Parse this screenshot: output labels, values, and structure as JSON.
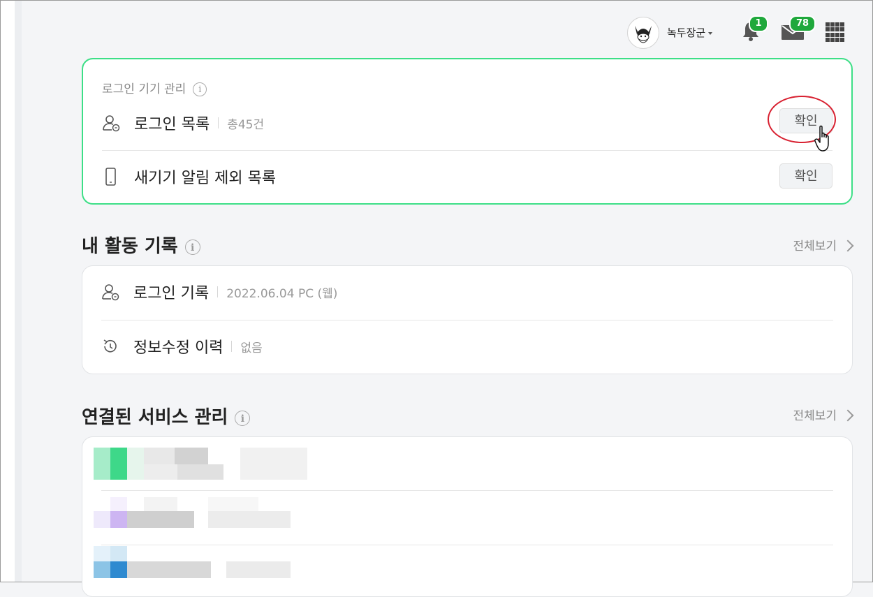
{
  "header": {
    "username": "녹두장군",
    "notifications_count": "1",
    "mail_count": "78"
  },
  "login_devices": {
    "title": "로그인 기기 관리",
    "info_glyph": "i",
    "rows": [
      {
        "label": "로그인 목록",
        "meta": "총45건",
        "button": "확인",
        "icon": "user-login-icon"
      },
      {
        "label": "새기기 알림 제외 목록",
        "meta": "",
        "button": "확인",
        "icon": "phone-icon"
      }
    ]
  },
  "activity": {
    "title": "내 활동 기록",
    "info_glyph": "i",
    "view_all": "전체보기",
    "rows": [
      {
        "label": "로그인 기록",
        "meta": "2022.06.04 PC (웹)",
        "icon": "user-login-icon"
      },
      {
        "label": "정보수정 이력",
        "meta": "없음",
        "icon": "history-icon"
      }
    ]
  },
  "services": {
    "title": "연결된 서비스 관리",
    "info_glyph": "i",
    "view_all": "전체보기"
  },
  "colors": {
    "accent_green": "#3ddf87",
    "badge_green": "#1fa83c",
    "annotation_red": "#d82030"
  }
}
